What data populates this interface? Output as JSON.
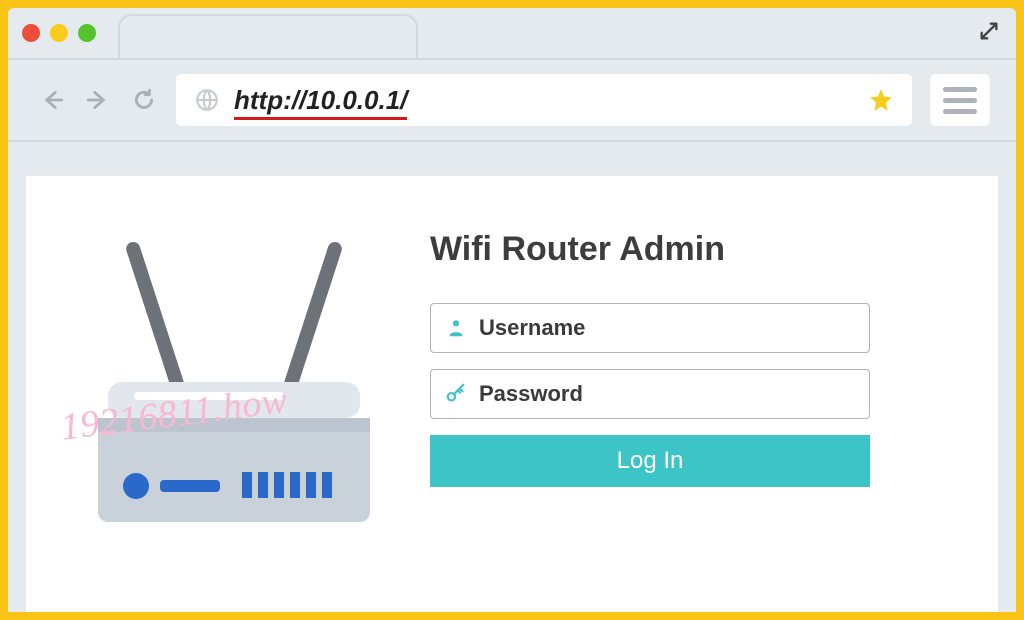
{
  "browser": {
    "url": "http://10.0.0.1/"
  },
  "page": {
    "title": "Wifi Router Admin",
    "username_placeholder": "Username",
    "password_placeholder": "Password",
    "login_label": "Log In"
  },
  "watermark": "19216811.how",
  "colors": {
    "frame_border": "#fac417",
    "accent_button": "#3cc4c6",
    "url_underline": "#d11c1c"
  }
}
